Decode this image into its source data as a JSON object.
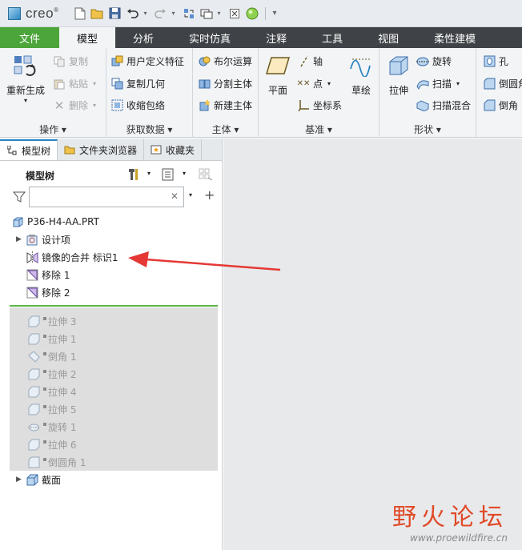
{
  "app": {
    "logo_text": "creo",
    "brand_color": "#4ca53b"
  },
  "quick_access": [
    "new-icon",
    "open-icon",
    "save-icon",
    "undo-icon",
    "redo-icon",
    "regenerate-icon",
    "windows-icon",
    "close-icon",
    "appearance-icon",
    "customize-icon"
  ],
  "tabs": [
    "文件",
    "模型",
    "分析",
    "实时仿真",
    "注释",
    "工具",
    "视图",
    "柔性建模"
  ],
  "active_tab": "模型",
  "ribbon": {
    "regen": {
      "label": "重新生成"
    },
    "ops": {
      "copy": "复制",
      "paste": "粘贴",
      "delete": "删除",
      "group": "操作"
    },
    "getdata": {
      "udf": "用户定义特征",
      "copygeom": "复制几何",
      "shrinkwrap": "收缩包络",
      "group": "获取数据"
    },
    "body": {
      "boolean": "布尔运算",
      "split": "分割主体",
      "newbody": "新建主体",
      "group": "主体"
    },
    "datum": {
      "plane": "平面",
      "axis": "轴",
      "point": "点",
      "csys": "坐标系",
      "sketch": "草绘",
      "group": "基准"
    },
    "shapes": {
      "extrude": "拉伸",
      "revolve": "旋转",
      "sweep": "扫描",
      "swept_blend": "扫描混合",
      "group": "形状"
    },
    "eng": {
      "hole": "孔",
      "round": "倒圆角",
      "chamfer": "倒角"
    }
  },
  "panel": {
    "tabs": [
      "模型树",
      "文件夹浏览器",
      "收藏夹"
    ],
    "title": "模型树",
    "search_placeholder": ""
  },
  "tree": {
    "root": "P36-H4-AA.PRT",
    "items": [
      {
        "label": "设计项",
        "icon": "design-items-icon",
        "expandable": true
      },
      {
        "label": "镜像的合并 标识1",
        "icon": "mirror-merge-icon",
        "expandable": false
      },
      {
        "label": "移除 1",
        "icon": "remove-icon",
        "expandable": false
      },
      {
        "label": "移除 2",
        "icon": "remove-icon",
        "expandable": false
      }
    ],
    "suppressed": [
      {
        "label": "拉伸 3",
        "icon": "extrude-icon"
      },
      {
        "label": "拉伸 1",
        "icon": "extrude-icon"
      },
      {
        "label": "倒角 1",
        "icon": "chamfer-icon"
      },
      {
        "label": "拉伸 2",
        "icon": "extrude-icon"
      },
      {
        "label": "拉伸 4",
        "icon": "extrude-icon"
      },
      {
        "label": "拉伸 5",
        "icon": "extrude-icon"
      },
      {
        "label": "旋转 1",
        "icon": "revolve-icon"
      },
      {
        "label": "拉伸 6",
        "icon": "extrude-icon"
      },
      {
        "label": "倒圆角 1",
        "icon": "round-icon"
      }
    ],
    "section": "截面"
  },
  "watermark": {
    "text": "野火论坛",
    "url": "www.proewildfire.cn"
  },
  "annotation_color": "#e53935"
}
